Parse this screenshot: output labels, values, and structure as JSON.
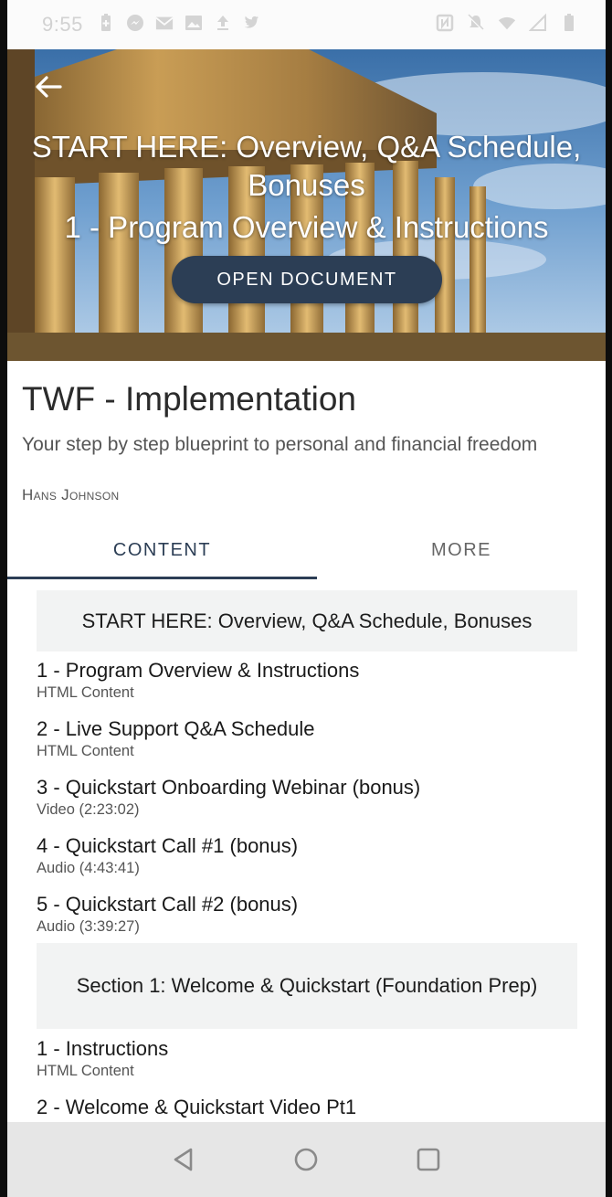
{
  "status_bar": {
    "time": "9:55",
    "left_icons": [
      "battery-saver-icon",
      "messenger-icon",
      "gmail-icon",
      "image-icon",
      "upload-icon",
      "twitter-icon"
    ],
    "right_icons": [
      "nfc-icon",
      "notifications-off-icon",
      "wifi-icon",
      "signal-icon",
      "battery-icon"
    ]
  },
  "hero": {
    "back_icon": "back-arrow-icon",
    "title": "START HERE: Overview, Q&A Schedule, Bonuses",
    "subtitle": "1 - Program Overview & Instructions",
    "open_button_label": "OPEN DOCUMENT"
  },
  "course": {
    "title": "TWF - Implementation",
    "description": "Your step by step blueprint to personal and financial freedom",
    "author": "Hans Johnson"
  },
  "tabs": [
    {
      "label": "CONTENT",
      "active": true
    },
    {
      "label": "MORE",
      "active": false
    }
  ],
  "sections": [
    {
      "title": "START HERE: Overview, Q&A Schedule, Bonuses",
      "items": [
        {
          "title": "1 - Program Overview & Instructions",
          "type": "HTML Content"
        },
        {
          "title": "2 - Live Support Q&A Schedule",
          "type": "HTML Content"
        },
        {
          "title": "3 - Quickstart Onboarding Webinar (bonus)",
          "type": "Video (2:23:02)"
        },
        {
          "title": "4 - Quickstart Call #1 (bonus)",
          "type": "Audio (4:43:41)"
        },
        {
          "title": "5 - Quickstart Call #2 (bonus)",
          "type": "Audio (3:39:27)"
        }
      ]
    },
    {
      "title": "Section 1: Welcome & Quickstart (Foundation Prep)",
      "items": [
        {
          "title": "1 - Instructions",
          "type": "HTML Content"
        },
        {
          "title": "2 - Welcome & Quickstart Video Pt1",
          "type": ""
        }
      ]
    }
  ],
  "nav_bar": {
    "icons": [
      "back-triangle-icon",
      "home-circle-icon",
      "recents-square-icon"
    ]
  },
  "colors": {
    "accent": "#2c3e55",
    "section_bg": "#f2f3f3",
    "nav_bg": "#e6e6e6"
  }
}
